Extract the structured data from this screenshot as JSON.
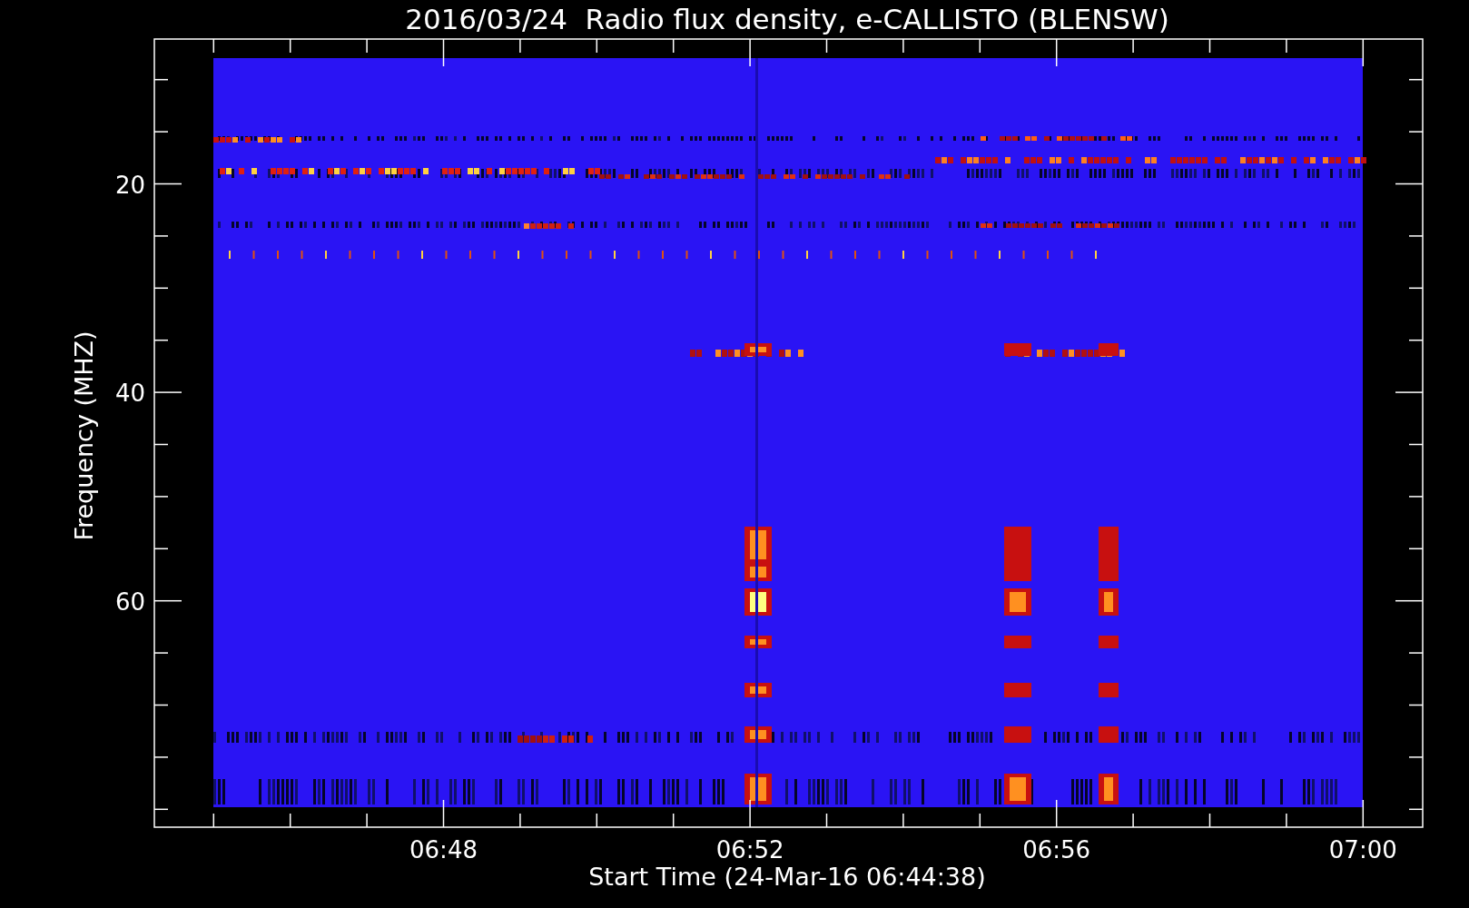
{
  "title": "2016/03/24  Radio flux density, e-CALLISTO (BLENSW)",
  "y_axis": {
    "label": "Frequency (MHZ)",
    "ticks": [
      "20",
      "40",
      "60"
    ]
  },
  "x_axis": {
    "label": "Start Time (24-Mar-16 06:44:38)",
    "ticks": [
      "06:48",
      "06:52",
      "06:56",
      "07:00"
    ]
  }
}
